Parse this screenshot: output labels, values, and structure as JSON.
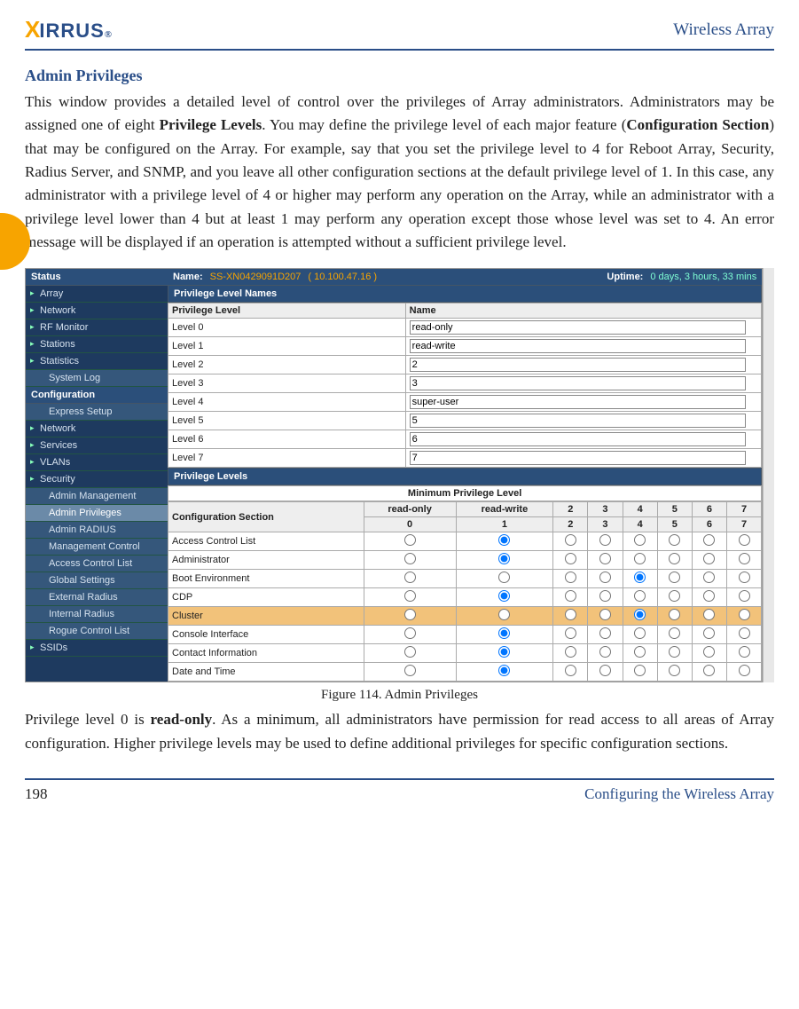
{
  "header": {
    "logo_x": "X",
    "logo_rest": "IRRUS",
    "logo_reg": "®",
    "right": "Wireless Array"
  },
  "section_title": "Admin Privileges",
  "para1_a": "This window provides a detailed level of control over the privileges of Array administrators. Administrators may be assigned one of eight ",
  "para1_b": "Privilege Levels",
  "para1_c": ". You may define the privilege level of each major feature (",
  "para1_d": "Configuration Section",
  "para1_e": ") that may be configured on the Array. For example, say that you set the privilege level to 4 for Reboot Array, Security, Radius Server, and SNMP, and you leave all other configuration sections at the default privilege level of 1. In this case, any administrator with a privilege level of 4 or higher may perform any operation on the Array, while an administrator with a privilege level lower than 4 but at least 1 may perform any operation except those whose level was set to 4. An error message will be displayed if an operation is attempted without a sufficient privilege level.",
  "figcaption": "Figure 114. Admin Privileges",
  "para2_a": "Privilege level 0 is ",
  "para2_b": "read-only",
  "para2_c": ". As a minimum, all administrators have permission for read access to all areas of Array configuration. Higher privilege levels may be used to define additional privileges for specific configuration sections.",
  "footer": {
    "page": "198",
    "section": "Configuring the Wireless Array"
  },
  "shot": {
    "status": {
      "status_label": "Status",
      "name_label": "Name:",
      "name_value": "SS-XN0429091D207",
      "ip": "( 10.100.47.16 )",
      "uptime_label": "Uptime:",
      "uptime_value": "0 days, 3 hours, 33 mins"
    },
    "side": {
      "status_items": [
        "Array",
        "Network",
        "RF Monitor",
        "Stations",
        "Statistics",
        "System Log"
      ],
      "config_header": "Configuration",
      "config_items": [
        "Express Setup",
        "Network",
        "Services",
        "VLANs",
        "Security"
      ],
      "security_sub": [
        "Admin Management",
        "Admin Privileges",
        "Admin RADIUS",
        "Management Control",
        "Access Control List",
        "Global Settings",
        "External Radius",
        "Internal Radius",
        "Rogue Control List"
      ],
      "ssids": "SSIDs"
    },
    "pln": {
      "title": "Privilege Level Names",
      "col1": "Privilege Level",
      "col2": "Name",
      "rows": [
        {
          "lvl": "Level 0",
          "name": "read-only"
        },
        {
          "lvl": "Level 1",
          "name": "read-write"
        },
        {
          "lvl": "Level 2",
          "name": "2"
        },
        {
          "lvl": "Level 3",
          "name": "3"
        },
        {
          "lvl": "Level 4",
          "name": "super-user"
        },
        {
          "lvl": "Level 5",
          "name": "5"
        },
        {
          "lvl": "Level 6",
          "name": "6"
        },
        {
          "lvl": "Level 7",
          "name": "7"
        }
      ]
    },
    "plv": {
      "title": "Privilege Levels",
      "minhdr": "Minimum Privilege Level",
      "col0": "Configuration Section",
      "cols": [
        {
          "top": "read-only",
          "bottom": "0"
        },
        {
          "top": "read-write",
          "bottom": "1"
        },
        {
          "top": "2",
          "bottom": "2"
        },
        {
          "top": "3",
          "bottom": "3"
        },
        {
          "top": "4",
          "bottom": "4"
        },
        {
          "top": "5",
          "bottom": "5"
        },
        {
          "top": "6",
          "bottom": "6"
        },
        {
          "top": "7",
          "bottom": "7"
        }
      ],
      "rows": [
        {
          "name": "Access Control List",
          "sel": 1,
          "hl": false
        },
        {
          "name": "Administrator",
          "sel": 1,
          "hl": false
        },
        {
          "name": "Boot Environment",
          "sel": 4,
          "hl": false
        },
        {
          "name": "CDP",
          "sel": 1,
          "hl": false
        },
        {
          "name": "Cluster",
          "sel": 4,
          "hl": true
        },
        {
          "name": "Console Interface",
          "sel": 1,
          "hl": false
        },
        {
          "name": "Contact Information",
          "sel": 1,
          "hl": false
        },
        {
          "name": "Date and Time",
          "sel": 1,
          "hl": false
        }
      ]
    }
  }
}
